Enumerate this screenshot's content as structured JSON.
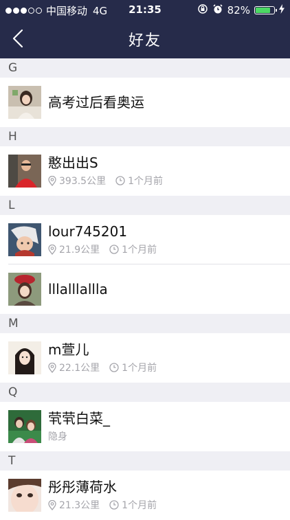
{
  "status_bar": {
    "carrier": "中国移动",
    "network": "4G",
    "time": "21:35",
    "battery_percent": "82%",
    "battery_level": 0.82,
    "signal_bars_filled": 3,
    "signal_bars_total": 5
  },
  "nav": {
    "title": "好友",
    "back_icon": "chevron-left-icon"
  },
  "sections": [
    {
      "letter": "G",
      "friends": [
        {
          "name": "高考过后看奥运",
          "distance": "",
          "time": "",
          "status": ""
        }
      ]
    },
    {
      "letter": "H",
      "friends": [
        {
          "name": "憨出出S",
          "distance": "393.5公里",
          "time": "1个月前",
          "status": ""
        }
      ]
    },
    {
      "letter": "L",
      "friends": [
        {
          "name": "lour745201",
          "distance": "21.9公里",
          "time": "1个月前",
          "status": ""
        },
        {
          "name": "lllalllalllа",
          "distance": "",
          "time": "",
          "status": ""
        }
      ]
    },
    {
      "letter": "M",
      "friends": [
        {
          "name": "m萱儿",
          "distance": "22.1公里",
          "time": "1个月前",
          "status": ""
        }
      ]
    },
    {
      "letter": "Q",
      "friends": [
        {
          "name": "茕茕白菜_",
          "distance": "",
          "time": "",
          "status": "隐身"
        }
      ]
    },
    {
      "letter": "T",
      "friends": [
        {
          "name": "彤彤薄荷水",
          "distance": "21.3公里",
          "time": "1个月前",
          "status": ""
        }
      ]
    }
  ],
  "colors": {
    "header_bg": "#262b4a",
    "section_bg": "#efeff4",
    "meta_text": "#a4a4aa",
    "battery_fill": "#4cd964"
  }
}
